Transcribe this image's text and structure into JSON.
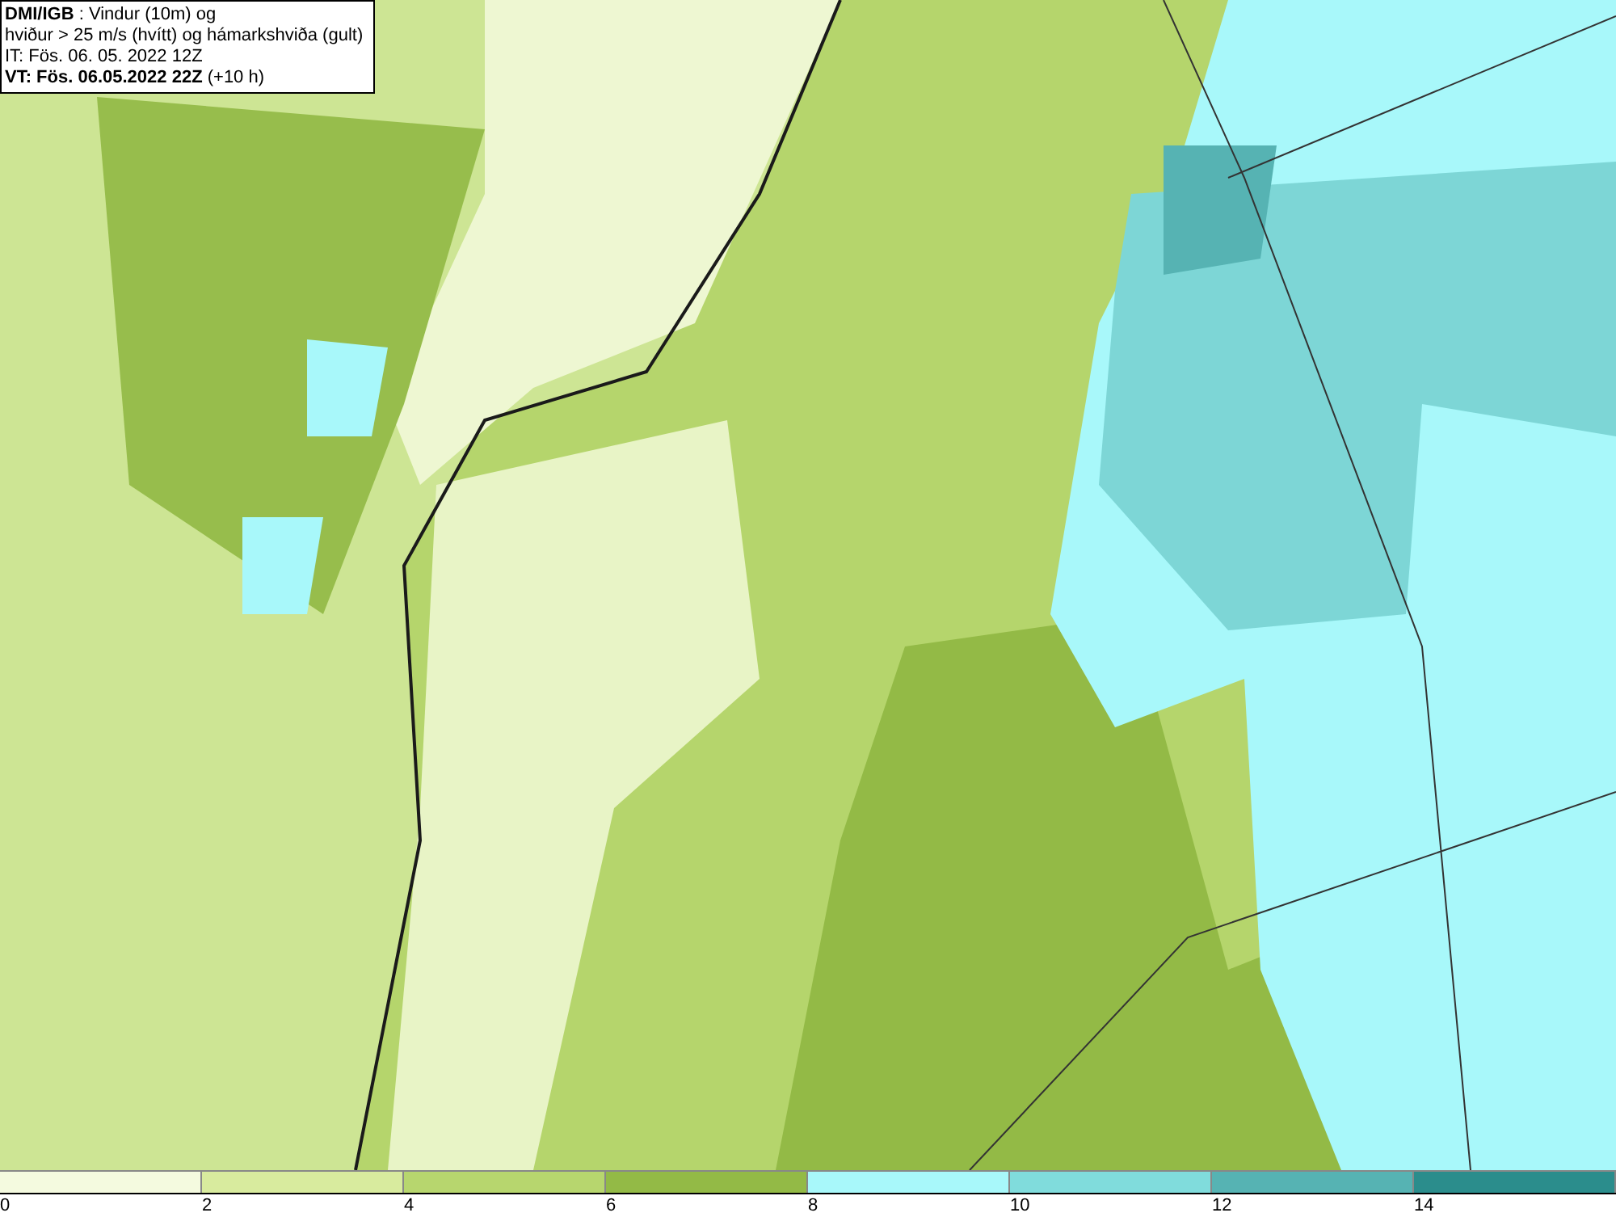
{
  "info_box": {
    "lines": [
      "**DMI/IGB** : Vindur (10m) og",
      "hviður > 25 m/s (hvítt) og hámarkshviða (gult)",
      "IT: Fös. 06. 05. 2022 12Z",
      "**VT: Fös. 06.05.2022 22Z** (+10 h)"
    ]
  },
  "legend": {
    "segments": [
      {
        "label": "0",
        "color": "#f4fadf"
      },
      {
        "label": "2",
        "color": "#d8eb9e"
      },
      {
        "label": "4",
        "color": "#b7d66e"
      },
      {
        "label": "6",
        "color": "#93ba46"
      },
      {
        "label": "8",
        "color": "#a8f8fa"
      },
      {
        "label": "10",
        "color": "#80dcdc"
      },
      {
        "label": "12",
        "color": "#56b3b3"
      },
      {
        "label": "14",
        "color": "#2b8d8c"
      }
    ]
  }
}
